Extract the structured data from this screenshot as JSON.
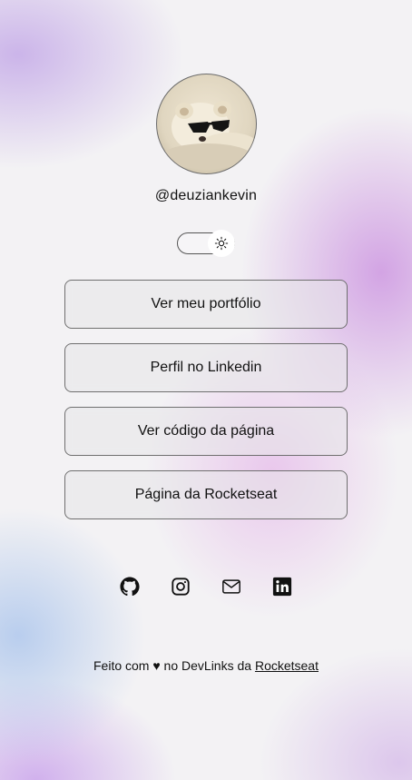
{
  "profile": {
    "username": "@deuziankevin",
    "avatar_alt": "avatar"
  },
  "theme_switch": {
    "icon": "sun-icon"
  },
  "links": [
    {
      "label": "Ver meu portfólio"
    },
    {
      "label": "Perfil no Linkedin"
    },
    {
      "label": "Ver código da página"
    },
    {
      "label": "Página da Rocketseat"
    }
  ],
  "socials": [
    {
      "icon": "github-icon"
    },
    {
      "icon": "instagram-icon"
    },
    {
      "icon": "mail-icon"
    },
    {
      "icon": "linkedin-icon"
    }
  ],
  "footer": {
    "prefix": "Feito com ♥ no DevLinks da ",
    "link_label": "Rocketseat"
  },
  "colors": {
    "text": "#111111",
    "border": "#6f6f6f"
  }
}
